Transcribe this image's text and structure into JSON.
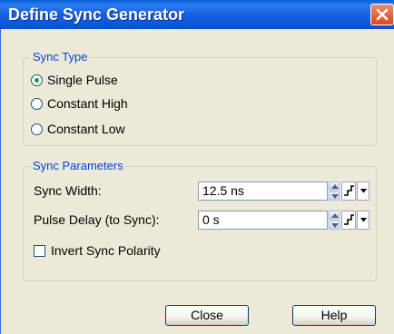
{
  "window": {
    "title": "Define Sync Generator",
    "close_icon": "close-icon"
  },
  "sync_type": {
    "legend": "Sync Type",
    "options": [
      {
        "label": "Single Pulse",
        "selected": true
      },
      {
        "label": "Constant High",
        "selected": false
      },
      {
        "label": "Constant Low",
        "selected": false
      }
    ]
  },
  "sync_parameters": {
    "legend": "Sync Parameters",
    "sync_width": {
      "label": "Sync Width:",
      "value": "12.5 ns"
    },
    "pulse_delay": {
      "label": "Pulse Delay (to Sync):",
      "value": "0 s"
    },
    "invert_polarity": {
      "label": "Invert Sync Polarity",
      "checked": false
    }
  },
  "buttons": {
    "close": "Close",
    "help": "Help"
  },
  "colors": {
    "title_bar": "#0b4fd1",
    "legend_text": "#0046d5",
    "close_button": "#d9491f",
    "radio_dot": "#21a121"
  }
}
